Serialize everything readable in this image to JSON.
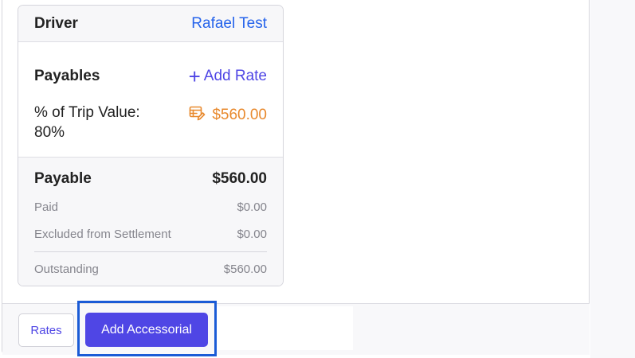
{
  "card": {
    "header": {
      "label": "Driver",
      "driver_name": "Rafael Test"
    },
    "payables": {
      "label": "Payables",
      "add_rate_label": "Add Rate"
    },
    "trip_rate": {
      "label_line1": "% of Trip Value:",
      "label_line2": "80%",
      "amount": "$560.00"
    },
    "summary": {
      "payable_label": "Payable",
      "payable_value": "$560.00",
      "paid_label": "Paid",
      "paid_value": "$0.00",
      "excluded_label": "Excluded from Settlement",
      "excluded_value": "$0.00",
      "outstanding_label": "Outstanding",
      "outstanding_value": "$560.00"
    }
  },
  "footer": {
    "rates_label": "Rates",
    "add_accessorial_label": "Add Accessorial"
  },
  "colors": {
    "accent": "#4f46e5",
    "link_blue": "#2563eb",
    "amount_orange": "#e8892d"
  },
  "icons": {
    "add_rate": "plus-icon",
    "trip_amount": "rate-edit-icon"
  }
}
